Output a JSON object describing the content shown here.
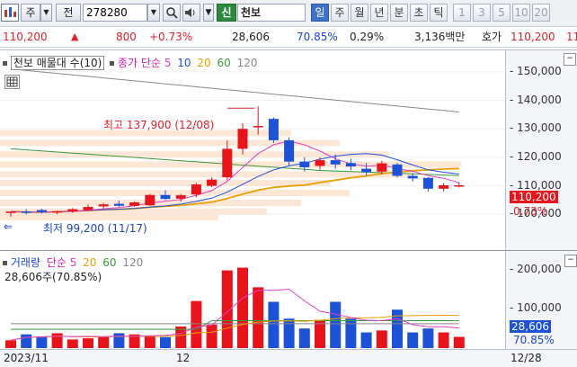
{
  "toolbar": {
    "market": "주",
    "type_label": "전",
    "code": "278280",
    "shin_label": "신",
    "name": "천보",
    "periods": [
      "일",
      "주",
      "월",
      "년",
      "분",
      "초",
      "틱"
    ],
    "active_period": "일",
    "numbers": [
      "1",
      "3",
      "5",
      "10",
      "20"
    ]
  },
  "info": {
    "price": "110,200",
    "change_arrow": "▲",
    "change": "800",
    "change_pct": "+0.73%",
    "volume": "28,606",
    "vol_ratio": "70.85%",
    "turnover_pct": "0.29%",
    "amount": "3,136백만",
    "hoga_label": "호가",
    "hoga_price": "110,200",
    "hoga_extra": "11"
  },
  "price_panel": {
    "title": "천보 매물대 수(10)",
    "ma_label": "종가 단순",
    "ma_periods": [
      "5",
      "10",
      "20",
      "60",
      "120"
    ],
    "ma_colors": [
      "#e040c8",
      "#2050e0",
      "#e8a000",
      "#3a9a3a",
      "#888888"
    ],
    "high_label": "최고 137,900 (12/08)",
    "low_label": "최저 99,200 (11/17)",
    "y_ticks": [
      "150,000",
      "140,000",
      "130,000",
      "120,000",
      "110,000",
      "100,000"
    ],
    "current_price": "110,200",
    "current_pct": "0.73%"
  },
  "volume_panel": {
    "title": "거래량",
    "ma_label": "단순",
    "ma_periods": [
      "5",
      "20",
      "60",
      "120"
    ],
    "value_label": "28,606주(70.85%)",
    "y_ticks": [
      "200,000",
      "100,000"
    ],
    "current_volume": "28,606",
    "current_pct": "70.85%"
  },
  "x_axis": {
    "labels": [
      "2023/11",
      "12"
    ],
    "right_label": "12/28"
  },
  "chart_data": {
    "type": "candlestick",
    "title": "천보 매물대 수(10)",
    "ylim": [
      90000,
      155000
    ],
    "candles": [
      {
        "o": 100500,
        "h": 101000,
        "l": 99200,
        "c": 101000,
        "v": 20000
      },
      {
        "o": 101000,
        "h": 101800,
        "l": 100000,
        "c": 100600,
        "v": 35000
      },
      {
        "o": 101500,
        "h": 102000,
        "l": 100300,
        "c": 100800,
        "v": 30000
      },
      {
        "o": 100900,
        "h": 101300,
        "l": 100000,
        "c": 101100,
        "v": 38000
      },
      {
        "o": 101100,
        "h": 102200,
        "l": 100500,
        "c": 101800,
        "v": 22000
      },
      {
        "o": 101500,
        "h": 103500,
        "l": 101200,
        "c": 102600,
        "v": 25000
      },
      {
        "o": 102800,
        "h": 104000,
        "l": 102000,
        "c": 103500,
        "v": 30000
      },
      {
        "o": 103700,
        "h": 104800,
        "l": 102600,
        "c": 103000,
        "v": 38000
      },
      {
        "o": 103000,
        "h": 104600,
        "l": 102700,
        "c": 104200,
        "v": 35000
      },
      {
        "o": 103200,
        "h": 107200,
        "l": 103000,
        "c": 106800,
        "v": 30000
      },
      {
        "o": 106800,
        "h": 108500,
        "l": 105000,
        "c": 105400,
        "v": 28000
      },
      {
        "o": 105500,
        "h": 107200,
        "l": 104500,
        "c": 106700,
        "v": 55000
      },
      {
        "o": 107000,
        "h": 111000,
        "l": 106000,
        "c": 110500,
        "v": 120000
      },
      {
        "o": 110000,
        "h": 113000,
        "l": 109500,
        "c": 112200,
        "v": 60000
      },
      {
        "o": 113000,
        "h": 126000,
        "l": 112000,
        "c": 123000,
        "v": 198000
      },
      {
        "o": 123000,
        "h": 132000,
        "l": 121000,
        "c": 130000,
        "v": 205000
      },
      {
        "o": 131000,
        "h": 137900,
        "l": 128000,
        "c": 131000,
        "v": 155000
      },
      {
        "o": 133500,
        "h": 134000,
        "l": 125000,
        "c": 126000,
        "v": 118000
      },
      {
        "o": 126000,
        "h": 127000,
        "l": 117000,
        "c": 118500,
        "v": 75000
      },
      {
        "o": 118500,
        "h": 120000,
        "l": 115000,
        "c": 116500,
        "v": 50000
      },
      {
        "o": 117000,
        "h": 120000,
        "l": 115500,
        "c": 119000,
        "v": 72000
      },
      {
        "o": 119000,
        "h": 121000,
        "l": 116000,
        "c": 117500,
        "v": 118000
      },
      {
        "o": 118000,
        "h": 119500,
        "l": 115500,
        "c": 116800,
        "v": 75000
      },
      {
        "o": 116000,
        "h": 118000,
        "l": 113500,
        "c": 114800,
        "v": 40000
      },
      {
        "o": 115000,
        "h": 118800,
        "l": 114000,
        "c": 117900,
        "v": 45000
      },
      {
        "o": 117500,
        "h": 118000,
        "l": 113000,
        "c": 113500,
        "v": 98000
      },
      {
        "o": 113500,
        "h": 114500,
        "l": 111500,
        "c": 112600,
        "v": 40000
      },
      {
        "o": 112800,
        "h": 113000,
        "l": 108000,
        "c": 109000,
        "v": 50000
      },
      {
        "o": 109000,
        "h": 111000,
        "l": 108000,
        "c": 110200,
        "v": 40000
      },
      {
        "o": 110000,
        "h": 111200,
        "l": 109400,
        "c": 110200,
        "v": 28606
      }
    ],
    "volume_ylim": [
      0,
      220000
    ],
    "volume_profile": [
      {
        "price": 99000,
        "width": 0.45
      },
      {
        "price": 101000,
        "width": 0.55
      },
      {
        "price": 104000,
        "width": 0.62
      },
      {
        "price": 107500,
        "width": 0.72
      },
      {
        "price": 111000,
        "width": 0.68
      },
      {
        "price": 114000,
        "width": 0.85
      },
      {
        "price": 117500,
        "width": 0.95
      },
      {
        "price": 121000,
        "width": 0.8
      },
      {
        "price": 125000,
        "width": 0.7
      },
      {
        "price": 128500,
        "width": 0.6
      }
    ]
  },
  "colors": {
    "up": "#e8141c",
    "down": "#1d52d6",
    "axis_bg": "#f3f5f9"
  }
}
